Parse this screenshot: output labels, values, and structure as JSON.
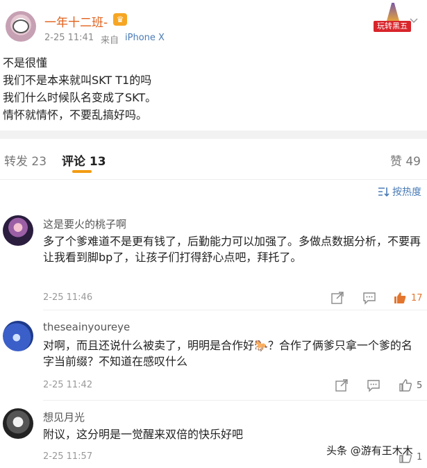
{
  "post": {
    "username": "一年十二班-",
    "badge_icon": "vip-crown-icon",
    "time": "2-25 11:41",
    "source_label": "来自",
    "device": "iPhone X",
    "lines": [
      "不是很懂",
      "我们不是本来就叫SKT T1的吗",
      "我们什么时候队名变成了SKT。",
      "情怀就情怀，不要乱搞好吗。"
    ],
    "promo_tag": "玩转黑五"
  },
  "tabs": {
    "repost": "转发 23",
    "comments": "评论 13",
    "likes": "赞 49"
  },
  "sort_label": "按热度",
  "comments": [
    {
      "name": "这是要火的桃子啊",
      "text": "多了个爹难道不是更有钱了，后勤能力可以加强了。多做点数据分析，不要再让我看到脚bp了，让孩子们打得舒心点吧，拜托了。",
      "time": "2-25 11:46",
      "likes": "17"
    },
    {
      "name": "theseainyoureye",
      "text": "对啊，而且还说什么被卖了，明明是合作好🐎？合作了俩爹只拿一个爹的名字当前缀？不知道在感叹什么",
      "time": "2-25 11:42",
      "likes": "5"
    },
    {
      "name": "想见月光",
      "text": "附议，这分明是一觉醒来双倍的快乐好吧",
      "time": "2-25 11:57",
      "likes": "1"
    }
  ],
  "watermark": "头条 @游有王木木",
  "colors": {
    "username": "#e0601a",
    "link": "#4a7bb5",
    "tab_underline": "#f39c12",
    "hot_like": "#e2762f"
  }
}
